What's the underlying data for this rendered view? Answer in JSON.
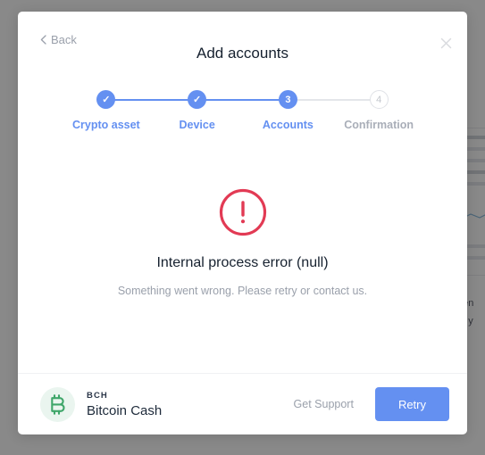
{
  "background": {
    "text_fragment_1": "pen",
    "text_fragment_2": "to y"
  },
  "modal": {
    "back_label": "Back",
    "title": "Add accounts",
    "close_icon": "close-icon",
    "stepper": {
      "steps": [
        {
          "marker": "✓",
          "label": "Crypto asset",
          "state": "complete"
        },
        {
          "marker": "✓",
          "label": "Device",
          "state": "complete"
        },
        {
          "marker": "3",
          "label": "Accounts",
          "state": "active"
        },
        {
          "marker": "4",
          "label": "Confirmation",
          "state": "pending"
        }
      ]
    },
    "error": {
      "icon": "error-circle-exclamation-icon",
      "title": "Internal process error (null)",
      "description": "Something went wrong. Please retry or contact us."
    },
    "footer": {
      "asset_icon": "bitcoin-cash-icon",
      "asset_ticker": "BCH",
      "asset_name": "Bitcoin Cash",
      "get_support_label": "Get Support",
      "retry_label": "Retry"
    }
  },
  "colors": {
    "accent_blue": "#6490f1",
    "error_red": "#e23a54",
    "asset_green": "#3fa66a",
    "title_navy": "#16212f",
    "muted_gray": "#9aa0ab"
  }
}
